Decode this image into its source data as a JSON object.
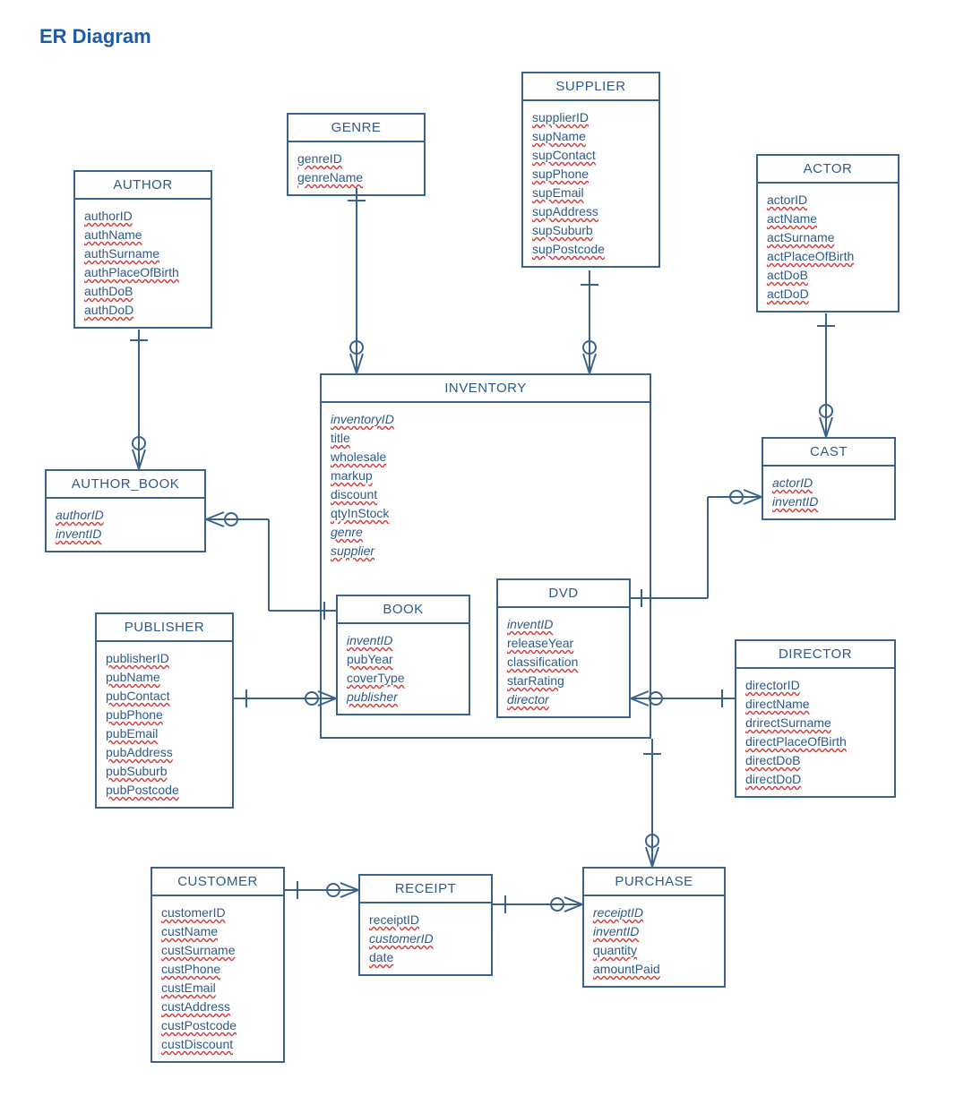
{
  "page": {
    "title": "ER Diagram"
  },
  "entities": {
    "author": {
      "name": "AUTHOR",
      "attrs": [
        "authorID",
        "authName",
        "authSurname",
        "authPlaceOfBirth",
        "authDoB",
        "authDoD"
      ]
    },
    "genre": {
      "name": "GENRE",
      "attrs": [
        "genreID",
        "genreName"
      ]
    },
    "supplier": {
      "name": "SUPPLIER",
      "attrs": [
        "supplierID",
        "supName",
        "supContact",
        "supPhone",
        "supEmail",
        "supAddress",
        "supSuburb",
        "supPostcode"
      ]
    },
    "actor": {
      "name": "ACTOR",
      "attrs": [
        "actorID",
        "actName",
        "actSurname",
        "actPlaceOfBirth",
        "actDoB",
        "actDoD"
      ]
    },
    "author_book": {
      "name": "AUTHOR_BOOK",
      "attrs": [
        "authorID",
        "inventID"
      ]
    },
    "inventory": {
      "name": "INVENTORY",
      "attrs": [
        "inventoryID",
        "title",
        "wholesale",
        "markup",
        "discount",
        "qtyInStock",
        "genre",
        "supplier"
      ]
    },
    "cast": {
      "name": "CAST",
      "attrs": [
        "actorID",
        "inventID"
      ]
    },
    "publisher": {
      "name": "PUBLISHER",
      "attrs": [
        "publisherID",
        "pubName",
        "pubContact",
        "pubPhone",
        "pubEmail",
        "pubAddress",
        "pubSuburb",
        "pubPostcode"
      ]
    },
    "book": {
      "name": "BOOK",
      "attrs": [
        "inventID",
        "pubYear",
        "coverType",
        "publisher"
      ]
    },
    "dvd": {
      "name": "DVD",
      "attrs": [
        "inventID",
        "releaseYear",
        "classification",
        "starRating",
        "director"
      ]
    },
    "director": {
      "name": "DIRECTOR",
      "attrs": [
        "directorID",
        "directName",
        "drirectSurname",
        "directPlaceOfBirth",
        "directDoB",
        "directDoD"
      ]
    },
    "customer": {
      "name": "CUSTOMER",
      "attrs": [
        "customerID",
        "custName",
        "custSurname",
        "custPhone",
        "custEmail",
        "custAddress",
        "custPostcode",
        "custDiscount"
      ]
    },
    "receipt": {
      "name": "RECEIPT",
      "attrs": [
        "receiptID",
        "customerID",
        "date"
      ]
    },
    "purchase": {
      "name": "PURCHASE",
      "attrs": [
        "receiptID",
        "inventID",
        "quantity",
        "amountPaid"
      ]
    }
  },
  "chart_data": {
    "type": "er_diagram",
    "entities": [
      {
        "name": "AUTHOR",
        "attributes": [
          "authorID",
          "authName",
          "authSurname",
          "authPlaceOfBirth",
          "authDoB",
          "authDoD"
        ],
        "pk": [
          "authorID"
        ]
      },
      {
        "name": "GENRE",
        "attributes": [
          "genreID",
          "genreName"
        ],
        "pk": [
          "genreID"
        ]
      },
      {
        "name": "SUPPLIER",
        "attributes": [
          "supplierID",
          "supName",
          "supContact",
          "supPhone",
          "supEmail",
          "supAddress",
          "supSuburb",
          "supPostcode"
        ],
        "pk": [
          "supplierID"
        ]
      },
      {
        "name": "ACTOR",
        "attributes": [
          "actorID",
          "actName",
          "actSurname",
          "actPlaceOfBirth",
          "actDoB",
          "actDoD"
        ],
        "pk": [
          "actorID"
        ]
      },
      {
        "name": "AUTHOR_BOOK",
        "attributes": [
          "authorID",
          "inventID"
        ],
        "pk": [
          "authorID",
          "inventID"
        ]
      },
      {
        "name": "INVENTORY",
        "attributes": [
          "inventoryID",
          "title",
          "wholesale",
          "markup",
          "discount",
          "qtyInStock",
          "genre",
          "supplier"
        ],
        "pk": [
          "inventoryID"
        ]
      },
      {
        "name": "CAST",
        "attributes": [
          "actorID",
          "inventID"
        ],
        "pk": [
          "actorID",
          "inventID"
        ]
      },
      {
        "name": "PUBLISHER",
        "attributes": [
          "publisherID",
          "pubName",
          "pubContact",
          "pubPhone",
          "pubEmail",
          "pubAddress",
          "pubSuburb",
          "pubPostcode"
        ],
        "pk": [
          "publisherID"
        ]
      },
      {
        "name": "BOOK",
        "attributes": [
          "inventID",
          "pubYear",
          "coverType",
          "publisher"
        ],
        "pk": [
          "inventID"
        ]
      },
      {
        "name": "DVD",
        "attributes": [
          "inventID",
          "releaseYear",
          "classification",
          "starRating",
          "director"
        ],
        "pk": [
          "inventID"
        ]
      },
      {
        "name": "DIRECTOR",
        "attributes": [
          "directorID",
          "directName",
          "drirectSurname",
          "directPlaceOfBirth",
          "directDoB",
          "directDoD"
        ],
        "pk": [
          "directorID"
        ]
      },
      {
        "name": "CUSTOMER",
        "attributes": [
          "customerID",
          "custName",
          "custSurname",
          "custPhone",
          "custEmail",
          "custAddress",
          "custPostcode",
          "custDiscount"
        ],
        "pk": [
          "customerID"
        ]
      },
      {
        "name": "RECEIPT",
        "attributes": [
          "receiptID",
          "customerID",
          "date"
        ],
        "pk": [
          "receiptID"
        ]
      },
      {
        "name": "PURCHASE",
        "attributes": [
          "receiptID",
          "inventID",
          "quantity",
          "amountPaid"
        ],
        "pk": [
          "receiptID",
          "inventID"
        ]
      }
    ],
    "relationships": [
      {
        "from": "AUTHOR",
        "to": "AUTHOR_BOOK",
        "cardinality": "1..*"
      },
      {
        "from": "AUTHOR_BOOK",
        "to": "BOOK",
        "cardinality": "0..*-1"
      },
      {
        "from": "GENRE",
        "to": "INVENTORY",
        "cardinality": "1-*"
      },
      {
        "from": "SUPPLIER",
        "to": "INVENTORY",
        "cardinality": "1-*"
      },
      {
        "from": "ACTOR",
        "to": "CAST",
        "cardinality": "1-*"
      },
      {
        "from": "CAST",
        "to": "DVD",
        "cardinality": "0..*-1"
      },
      {
        "from": "PUBLISHER",
        "to": "BOOK",
        "cardinality": "1-0..*"
      },
      {
        "from": "DVD",
        "to": "DIRECTOR",
        "cardinality": "0..*-1"
      },
      {
        "from": "INVENTORY",
        "to": "PURCHASE",
        "cardinality": "1-*",
        "via": "DVD"
      },
      {
        "from": "CUSTOMER",
        "to": "RECEIPT",
        "cardinality": "1-0..*"
      },
      {
        "from": "RECEIPT",
        "to": "PURCHASE",
        "cardinality": "1-0..*"
      }
    ]
  }
}
